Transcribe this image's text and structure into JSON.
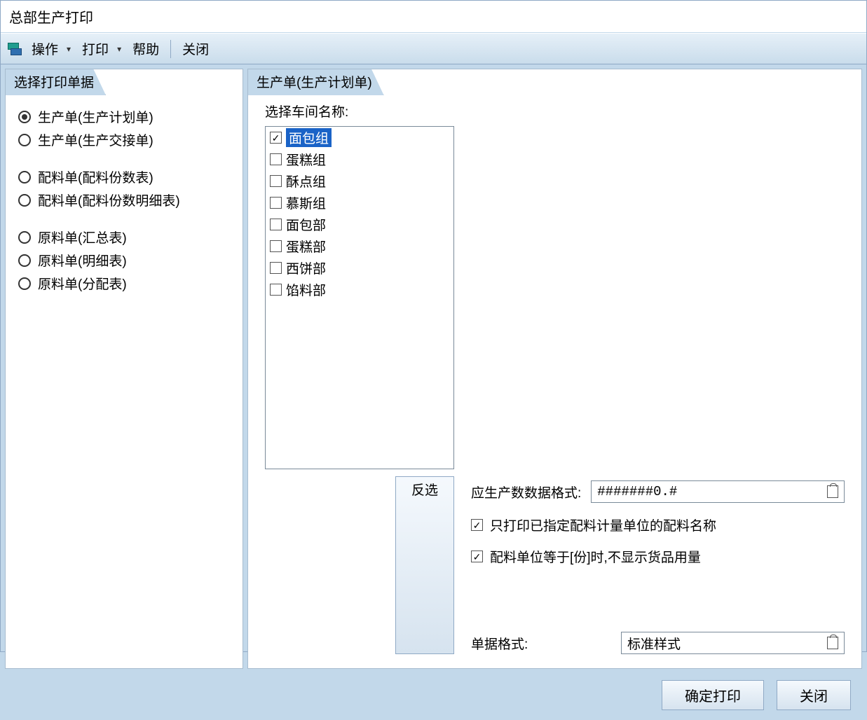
{
  "title": "总部生产打印",
  "toolbar": {
    "operate": "操作",
    "print": "打印",
    "help": "帮助",
    "close": "关闭"
  },
  "leftPanel": {
    "tab": "选择打印单据",
    "groups": [
      [
        "生产单(生产计划单)",
        "生产单(生产交接单)"
      ],
      [
        "配料单(配料份数表)",
        "配料单(配料份数明细表)"
      ],
      [
        "原料单(汇总表)",
        "原料单(明细表)",
        "原料单(分配表)"
      ]
    ],
    "selected": "生产单(生产计划单)"
  },
  "rightPanel": {
    "tab": "生产单(生产计划单)",
    "selectLabel": "选择车间名称:",
    "workshops": [
      {
        "label": "面包组",
        "checked": true,
        "selected": true
      },
      {
        "label": "蛋糕组",
        "checked": false
      },
      {
        "label": "酥点组",
        "checked": false
      },
      {
        "label": "慕斯组",
        "checked": false
      },
      {
        "label": "面包部",
        "checked": false
      },
      {
        "label": "蛋糕部",
        "checked": false
      },
      {
        "label": "西饼部",
        "checked": false
      },
      {
        "label": "馅料部",
        "checked": false
      }
    ],
    "invert": "反选",
    "formatLabel": "应生产数数据格式:",
    "formatValue": "#######0.#",
    "opt1": "只打印已指定配料计量单位的配料名称",
    "opt2": "配料单位等于[份]时,不显示货品用量",
    "docFormatLabel": "单据格式:",
    "docFormatValue": "标准样式"
  },
  "footer": {
    "ok": "确定打印",
    "close": "关闭"
  }
}
